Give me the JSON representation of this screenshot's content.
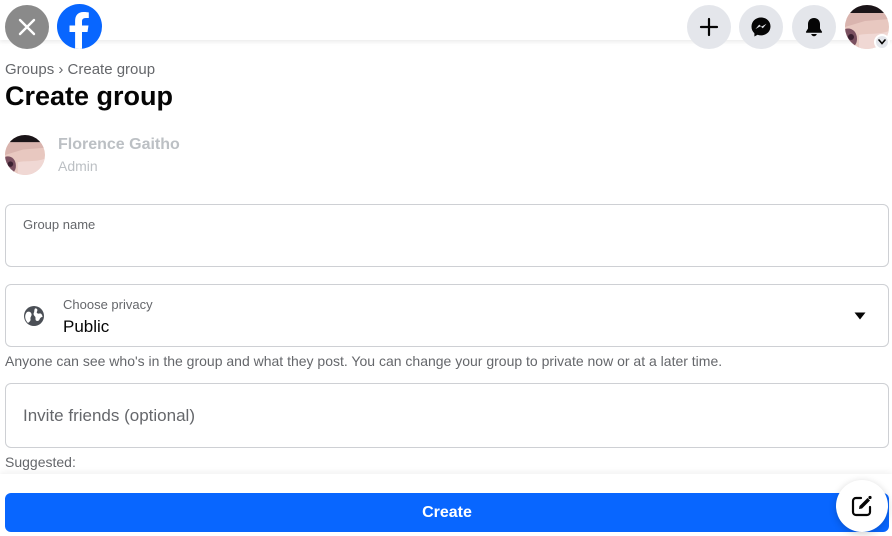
{
  "header": {
    "close_icon": "close-icon",
    "logo": "facebook-logo",
    "actions": [
      {
        "name": "create",
        "icon": "plus-icon"
      },
      {
        "name": "messenger",
        "icon": "messenger-icon"
      },
      {
        "name": "notifications",
        "icon": "bell-icon"
      },
      {
        "name": "account",
        "icon": "avatar"
      }
    ]
  },
  "breadcrumb": "Groups › Create group",
  "page_title": "Create group",
  "admin": {
    "name": "Florence Gaitho",
    "role": "Admin"
  },
  "form": {
    "group_name": {
      "label": "Group name",
      "value": ""
    },
    "privacy": {
      "label": "Choose privacy",
      "value": "Public",
      "icon": "globe-icon"
    },
    "privacy_help": "Anyone can see who's in the group and what they post. You can change your group to private now or at a later time.",
    "invite": {
      "placeholder": "Invite friends (optional)",
      "value": ""
    },
    "suggested_label": "Suggested:"
  },
  "actions": {
    "create_label": "Create"
  },
  "colors": {
    "brand": "#0866ff",
    "icon_bg": "#e4e6eb",
    "secondary_text": "#65676b"
  }
}
